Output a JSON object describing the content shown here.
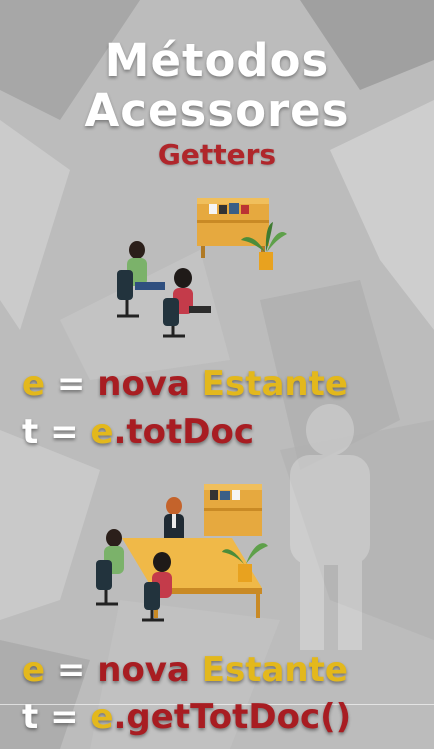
{
  "title_line1": "Métodos",
  "title_line2": "Acessores",
  "subtitle": "Getters",
  "code1": {
    "line1": {
      "var": "e",
      "eq": " = ",
      "kw": "nova",
      "cls": " Estante"
    },
    "line2": {
      "var": "t",
      "eq": " = ",
      "obj": "e",
      "dot": ".",
      "attr": "totDoc"
    }
  },
  "code2": {
    "line1": {
      "var": "e",
      "eq": " = ",
      "kw": "nova",
      "cls": " Estante"
    },
    "line2": {
      "var": "t",
      "eq": " = ",
      "obj": "e",
      "dot": ".",
      "method": "getTotDoc()"
    }
  },
  "colors": {
    "accent_yellow": "#e3b81c",
    "accent_red": "#a81d22",
    "background": "#bdbdbd"
  }
}
